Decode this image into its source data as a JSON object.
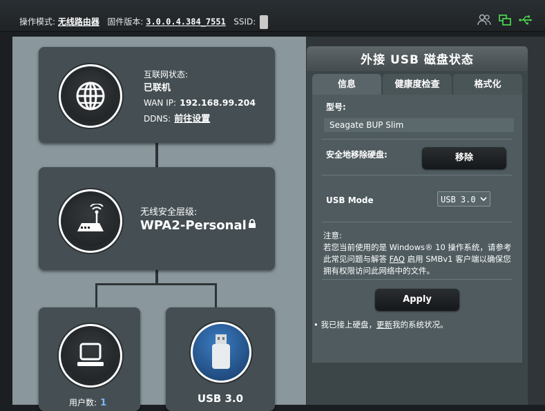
{
  "topbar": {
    "mode_label": "操作模式:",
    "mode_value": "无线路由器",
    "firmware_label": "固件版本:",
    "firmware_value": "3.0.0.4.384_7551",
    "ssid_label": "SSID:"
  },
  "map": {
    "internet": {
      "status_label": "互联网状态:",
      "status_value": "已联机",
      "wan_label": "WAN IP:",
      "wan_value": "192.168.99.204",
      "ddns_label": "DDNS:",
      "ddns_value": "前往设置"
    },
    "wireless": {
      "security_label": "无线安全层级:",
      "security_value": "WPA2-Personal"
    },
    "clients": {
      "label": "用户数:",
      "count": "1"
    },
    "usb": {
      "label": "USB 3.0"
    }
  },
  "panel": {
    "title": "外接 USB 磁盘状态",
    "tabs": [
      "信息",
      "健康度检查",
      "格式化"
    ],
    "model_label": "型号:",
    "model_value": "Seagate BUP Slim",
    "eject_label": "安全地移除硬盘:",
    "eject_button": "移除",
    "usb_mode_label": "USB Mode",
    "usb_mode_value": "USB 3.0",
    "note_title": "注意:",
    "note_part1": "若您当前使用的是 Windows® 10 操作系统，请参考此常见问题与解答 ",
    "note_faq": "FAQ",
    "note_part2": " 启用 SMBv1 客户端以确保您拥有权限访问此网络中的文件。",
    "apply_button": "Apply",
    "bullet_part1": "我已接上硬盘，",
    "bullet_link": "更新",
    "bullet_part2": "我的系统状况。"
  },
  "icons": {
    "users": "users-icon",
    "network": "network-icon",
    "usb": "usb-icon"
  },
  "colors": {
    "accent_green": "#4bd04b",
    "client_count": "#7fb8ff"
  }
}
